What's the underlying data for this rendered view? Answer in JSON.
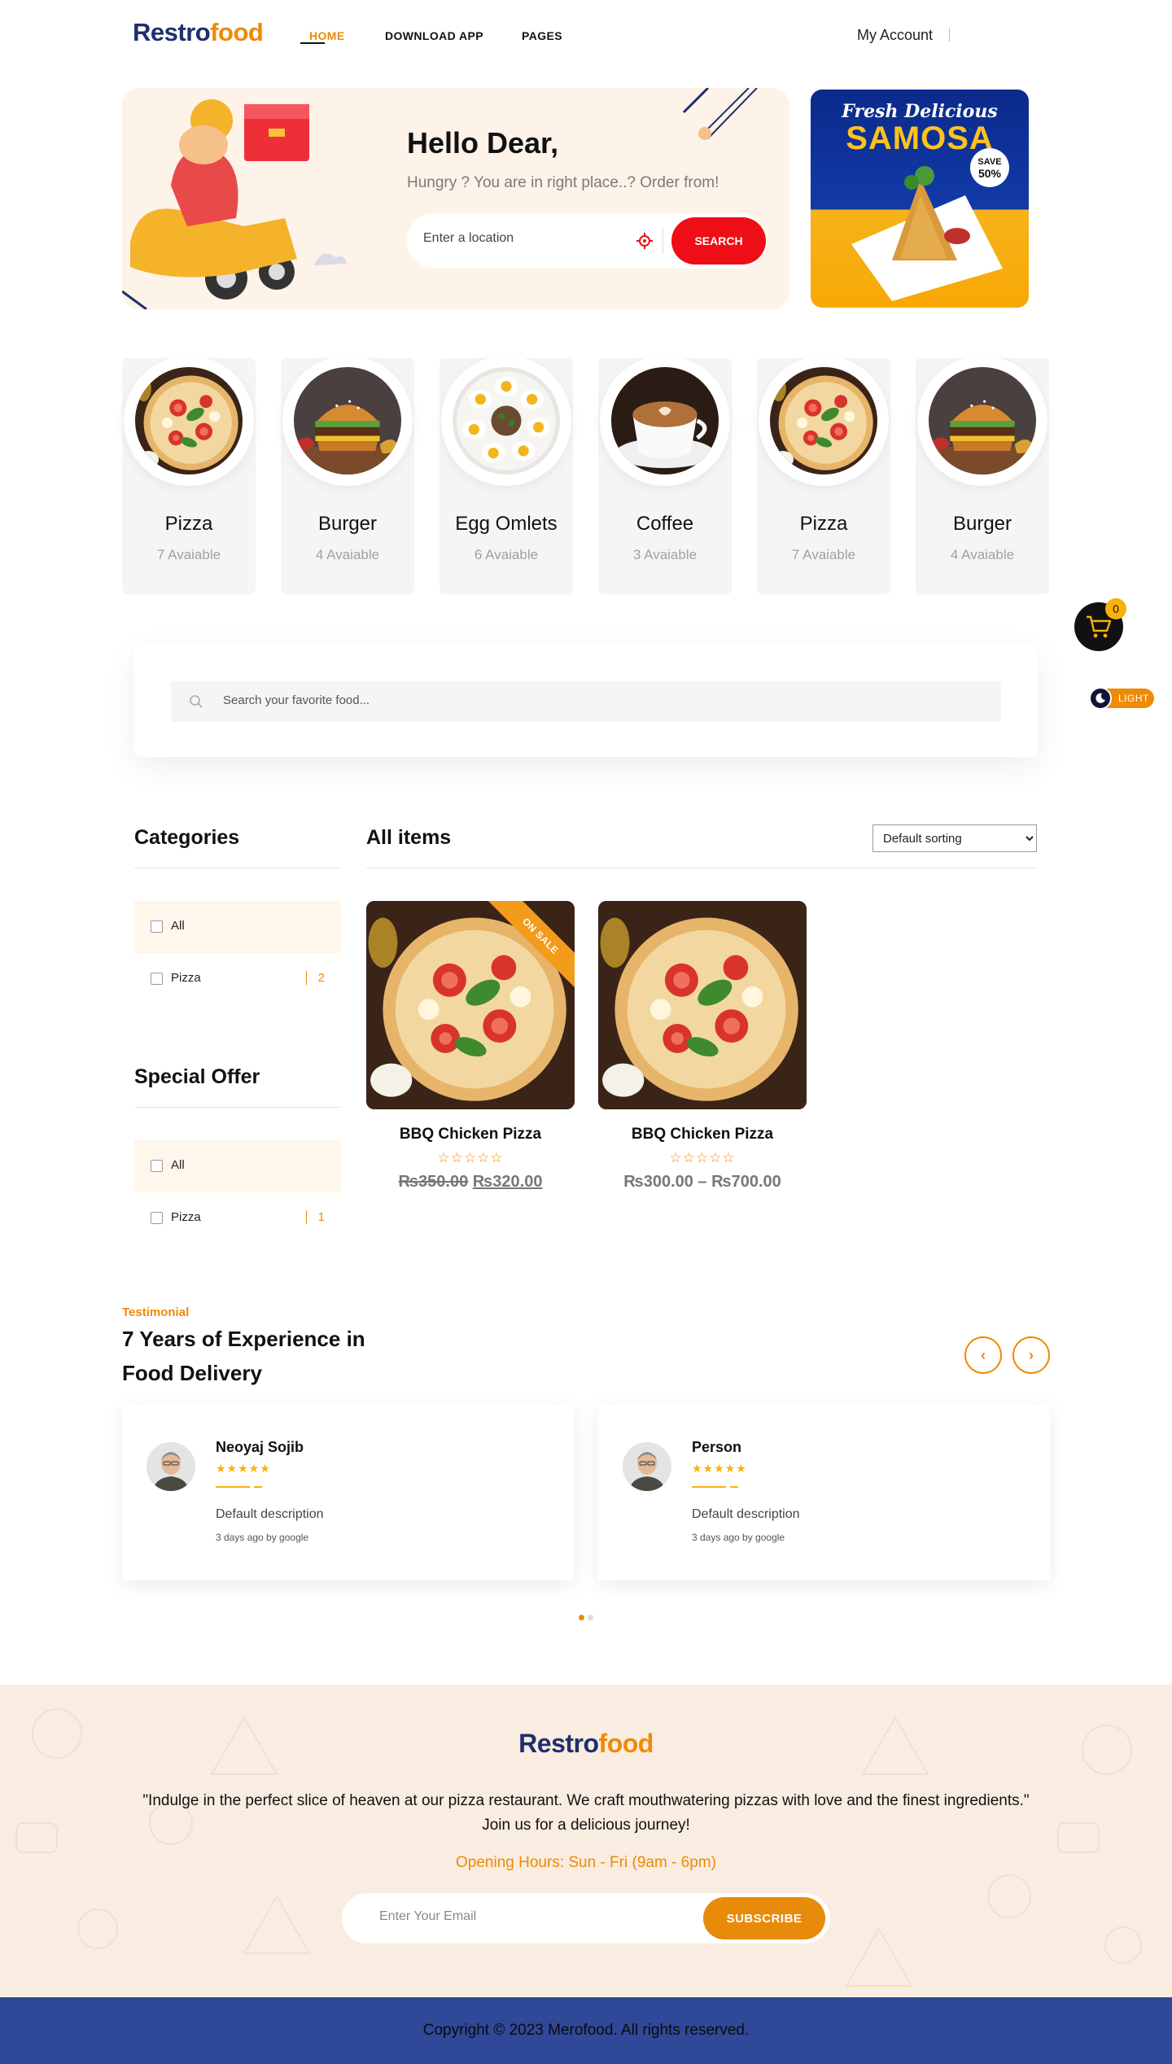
{
  "brand": {
    "logo_part1": "Restro",
    "logo_part2": "food",
    "primary": "#ee8a06",
    "dark": "#1f2f6d",
    "red": "#ee0e15"
  },
  "nav": {
    "home": "HOME",
    "download": "DOWNLOAD APP",
    "pages": "PAGES",
    "account": "My Account"
  },
  "hero": {
    "title": "Hello Dear,",
    "subtitle": "Hungry ? You are in right place..? Order from!",
    "location_placeholder": "Enter a location",
    "search_button": "SEARCH"
  },
  "promo": {
    "line1": "Fresh Delicious",
    "line2": "SAMOSA",
    "badge_top": "SAVE",
    "badge_bottom": "50%"
  },
  "categories_row": [
    {
      "name": "Pizza",
      "count": "7 Avaiable",
      "image": "pizza"
    },
    {
      "name": "Burger",
      "count": "4 Avaiable",
      "image": "burger"
    },
    {
      "name": "Egg Omlets",
      "count": "6 Avaiable",
      "image": "eggs"
    },
    {
      "name": "Coffee",
      "count": "3 Avaiable",
      "image": "coffee"
    },
    {
      "name": "Pizza",
      "count": "7 Avaiable",
      "image": "pizza"
    },
    {
      "name": "Burger",
      "count": "4 Avaiable",
      "image": "burger"
    }
  ],
  "cart": {
    "count": "0"
  },
  "theme": {
    "label": "LIGHT"
  },
  "food_search": {
    "placeholder": "Search your favorite food..."
  },
  "sidebar": {
    "categories_title": "Categories",
    "categories": [
      {
        "label": "All",
        "count": ""
      },
      {
        "label": "Pizza",
        "count": "2"
      }
    ],
    "special_title": "Special Offer",
    "special": [
      {
        "label": "All",
        "count": ""
      },
      {
        "label": "Pizza",
        "count": "1"
      }
    ]
  },
  "items": {
    "title": "All items",
    "sort_selected": "Default sorting",
    "products": [
      {
        "name": "BBQ Chicken Pizza",
        "stars": "☆☆☆☆☆",
        "price_old": "₨350.00",
        "price_new": "₨320.00",
        "ribbon": "ON SALE"
      },
      {
        "name": "BBQ Chicken Pizza",
        "stars": "☆☆☆☆☆",
        "price_range": "₨300.00 – ₨700.00"
      }
    ]
  },
  "testimonial": {
    "kicker": "Testimonial",
    "title": "7 Years of Experience in Food Delivery",
    "prev_icon": "‹",
    "next_icon": "›",
    "reviews": [
      {
        "name": "Neoyaj Sojib",
        "stars": "★★★★★",
        "desc": "Default description",
        "meta": "3 days ago by google"
      },
      {
        "name": "Person",
        "stars": "★★★★★",
        "desc": "Default description",
        "meta": "3 days ago by google"
      }
    ]
  },
  "footer": {
    "text": "\"Indulge in the perfect slice of heaven at our pizza restaurant. We craft mouthwatering pizzas with love and the finest ingredients.\" Join us for a delicious journey!",
    "hours": "Opening Hours: Sun - Fri (9am - 6pm)",
    "email_placeholder": "Enter Your Email",
    "subscribe_button": "SUBSCRIBE",
    "copyright": "Copyright © 2023 Merofood. All rights reserved."
  }
}
